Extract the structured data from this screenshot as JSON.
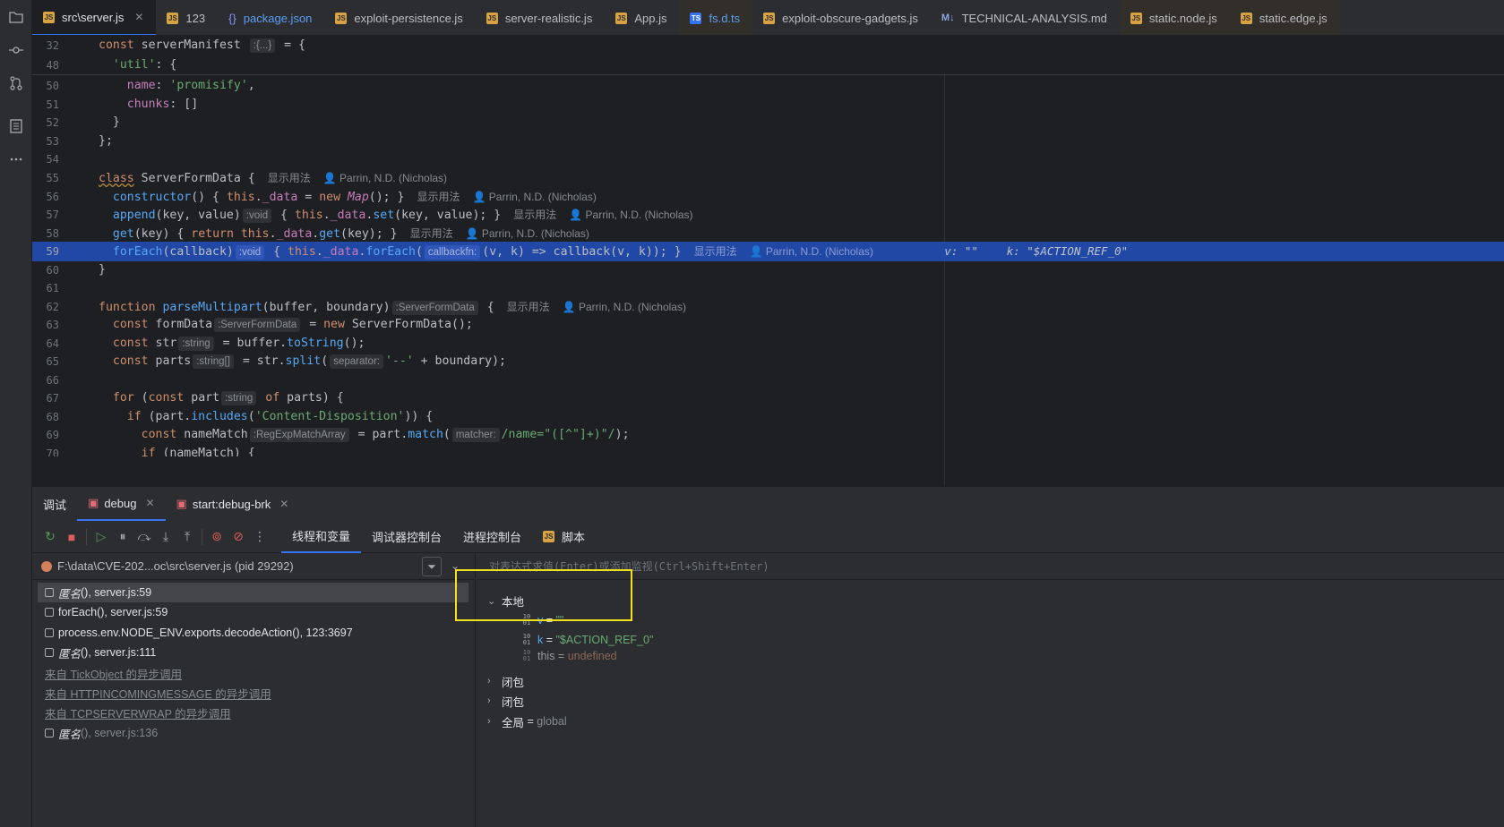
{
  "tabs": [
    {
      "label": "src\\server.js",
      "badge": "JS",
      "kind": "js",
      "active": true,
      "closable": true
    },
    {
      "label": "123",
      "badge": "JS",
      "kind": "js"
    },
    {
      "label": "package.json",
      "badge": "{}",
      "kind": "json",
      "blue": true
    },
    {
      "label": "exploit-persistence.js",
      "badge": "JS",
      "kind": "js"
    },
    {
      "label": "server-realistic.js",
      "badge": "JS",
      "kind": "js"
    },
    {
      "label": "App.js",
      "badge": "JS",
      "kind": "js"
    },
    {
      "label": "fs.d.ts",
      "badge": "TS",
      "kind": "ts",
      "blue": true,
      "highlight": true
    },
    {
      "label": "exploit-obscure-gadgets.js",
      "badge": "JS",
      "kind": "js"
    },
    {
      "label": "TECHNICAL-ANALYSIS.md",
      "badge": "M↓",
      "kind": "md"
    },
    {
      "label": "static.node.js",
      "badge": "JS",
      "kind": "js",
      "highlight": true
    },
    {
      "label": "static.edge.js",
      "badge": "JS",
      "kind": "js",
      "highlight": true
    }
  ],
  "editor": {
    "sticky": [
      {
        "ln": "32",
        "before": "const serverManifest",
        "hint": ":{...}",
        "after": " = {"
      },
      {
        "ln": "48",
        "indent": "  ",
        "str": "'util'",
        "after": ": {"
      }
    ],
    "lines": {
      "l50": {
        "ln": "50",
        "prop": "name",
        "str": "'promisify'"
      },
      "l51": {
        "ln": "51",
        "prop": "chunks",
        "rest": ": []"
      },
      "l52": {
        "ln": "52",
        "text": "  }"
      },
      "l53": {
        "ln": "53",
        "text": "};"
      },
      "l54": {
        "ln": "54"
      },
      "l55": {
        "ln": "55",
        "kw": "class",
        "name": "ServerFormData",
        "rest": " {"
      },
      "l56": {
        "ln": "56",
        "fn": "constructor",
        "a": "() { ",
        "kw1": "this",
        "b": ".",
        "prop": "_data",
        "c": " = ",
        "kw2": "new",
        "cls": "Map",
        "d": "(); }"
      },
      "l57": {
        "ln": "57",
        "fn": "append",
        "a": "(key, value)",
        "hint": ":void",
        "b": " { ",
        "kw": "this",
        "c": ".",
        "prop": "_data",
        "d": ".",
        "fn2": "set",
        "e": "(key, value); }"
      },
      "l58": {
        "ln": "58",
        "fn": "get",
        "a": "(key) { ",
        "kw": "return",
        "kw2": "this",
        "b": ".",
        "prop": "_data",
        "c": ".",
        "fn2": "get",
        "d": "(key); }"
      },
      "l59": {
        "ln": "59",
        "fn": "forEach",
        "a": "(callback)",
        "hint": ":void",
        "b": " { ",
        "kw": "this",
        "c": ".",
        "prop": "_data",
        "d": ".",
        "fn2": "forEach",
        "e": "(",
        "hint2": "callbackfn:",
        "f": "(v, k) => callback(v, k)); }",
        "dbg_v": "v: \"\"",
        "dbg_k": "k: \"$ACTION_REF_0\""
      },
      "l60": {
        "ln": "60",
        "text": "}"
      },
      "l61": {
        "ln": "61"
      },
      "l62": {
        "ln": "62",
        "kw": "function",
        "fn": "parseMultipart",
        "a": "(buffer, boundary)",
        "hint": ":ServerFormData",
        "b": " {"
      },
      "l63": {
        "ln": "63",
        "kw": "const",
        "a": " formData",
        "hint": ":ServerFormData",
        "b": " = ",
        "kw2": "new",
        "c": " ServerFormData();"
      },
      "l64": {
        "ln": "64",
        "kw": "const",
        "a": " str",
        "hint": ":string",
        "b": " = buffer.",
        "fn": "toString",
        "c": "();"
      },
      "l65": {
        "ln": "65",
        "kw": "const",
        "a": " parts",
        "hint": ":string[]",
        "b": " = str.",
        "fn": "split",
        "c": "(",
        "hint2": "separator:",
        "str": "'--'",
        "d": " + boundary);"
      },
      "l66": {
        "ln": "66"
      },
      "l67": {
        "ln": "67",
        "kw": "for",
        "a": " (",
        "kw2": "const",
        "b": " part",
        "hint": ":string",
        "kw3": "of",
        "c": " parts) {"
      },
      "l68": {
        "ln": "68",
        "kw": "if",
        "a": " (part.",
        "fn": "includes",
        "b": "(",
        "str": "'Content-Disposition'",
        "c": ")) {"
      },
      "l69": {
        "ln": "69",
        "kw": "const",
        "a": " nameMatch",
        "hint": ":RegExpMatchArray",
        "b": " = part.",
        "fn": "match",
        "c": "(",
        "hint2": "matcher:",
        "str": "/name=\"([^\"]+)\"/",
        "d": ");"
      },
      "l70": {
        "ln": "70",
        "kw": "if",
        "a": " (nameMatch) {"
      }
    },
    "usages": "显示用法",
    "author": "Parrin, N.D. (Nicholas)"
  },
  "panel": {
    "tabs": [
      {
        "label": "调试"
      },
      {
        "label": "debug",
        "active": true,
        "closable": true
      },
      {
        "label": "start:debug-brk",
        "closable": true
      }
    ],
    "view_tabs": [
      "线程和变量",
      "调试器控制台",
      "进程控制台",
      "脚本"
    ],
    "process": "F:\\data\\CVE-202...oc\\src\\server.js (pid 29292)",
    "frames": [
      {
        "fn": "匿名",
        "loc": "(), server.js:59",
        "italic": true,
        "selected": true
      },
      {
        "fn": "forEach",
        "loc": "(), server.js:59"
      },
      {
        "fn": "process.env.NODE_ENV.exports.decodeAction",
        "loc": "(), 123:3697"
      },
      {
        "fn": "匿名",
        "loc": "(), server.js:111",
        "italic": true
      },
      {
        "async": "来自 TickObject 的异步调用"
      },
      {
        "async": "来自 HTTPINCOMINGMESSAGE 的异步调用"
      },
      {
        "async": "来自 TCPSERVERWRAP 的异步调用"
      },
      {
        "fn": "匿名",
        "loc": "(), server.js:136",
        "italic": true,
        "dim": true
      }
    ],
    "eval_placeholder": "对表达式求值(Enter)或添加监视(Ctrl+Shift+Enter)",
    "variables": {
      "local_label": "本地",
      "v": {
        "name": "v",
        "value": "\"\""
      },
      "k": {
        "name": "k",
        "value": "\"$ACTION_REF_0\""
      },
      "this": {
        "name": "this",
        "value": "undefined"
      },
      "closure1": "闭包",
      "closure2": "闭包",
      "global_label": "全局",
      "global_value": "global"
    }
  },
  "colors": {
    "accent": "#3574f0",
    "highlight_box": "#f3e01f",
    "current_line": "#2148a5"
  }
}
